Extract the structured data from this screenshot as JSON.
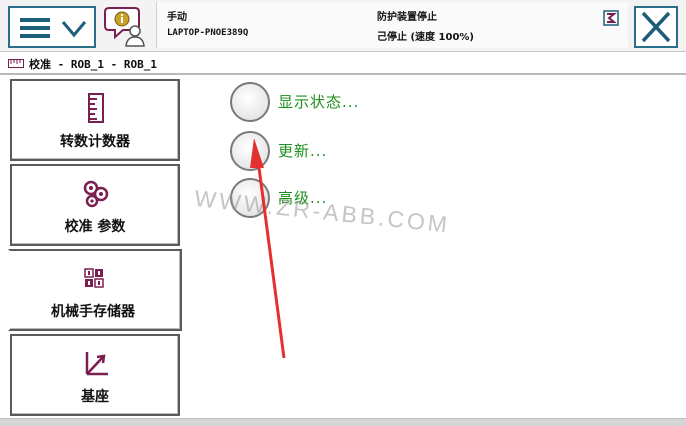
{
  "header": {
    "mode_label": "手动",
    "system_name": "LAPTOP-PNOE389Q",
    "safety_status": "防护装置停止",
    "run_status": "己停止 (速度 100%)"
  },
  "breadcrumb": {
    "text": "校准 - ROB_1 - ROB_1"
  },
  "sidebar": {
    "items": [
      {
        "label": "转数计数器",
        "icon": "rev-counter-icon"
      },
      {
        "label": "校准 参数",
        "icon": "calibration-params-icon"
      },
      {
        "label": "机械手存储器",
        "icon": "sms-memory-icon"
      },
      {
        "label": "基座",
        "icon": "base-frame-icon"
      }
    ],
    "active_index": 2
  },
  "options": {
    "items": [
      {
        "label": "显示状态..."
      },
      {
        "label": "更新..."
      },
      {
        "label": "高级..."
      }
    ]
  },
  "watermark": {
    "text": "WWW.ZR-ABB.COM"
  },
  "colors": {
    "accent": "#2a6d8a",
    "option_text": "#1c8f1c",
    "icon_purple": "#7a1f4f",
    "annotation_arrow": "#e53030"
  }
}
